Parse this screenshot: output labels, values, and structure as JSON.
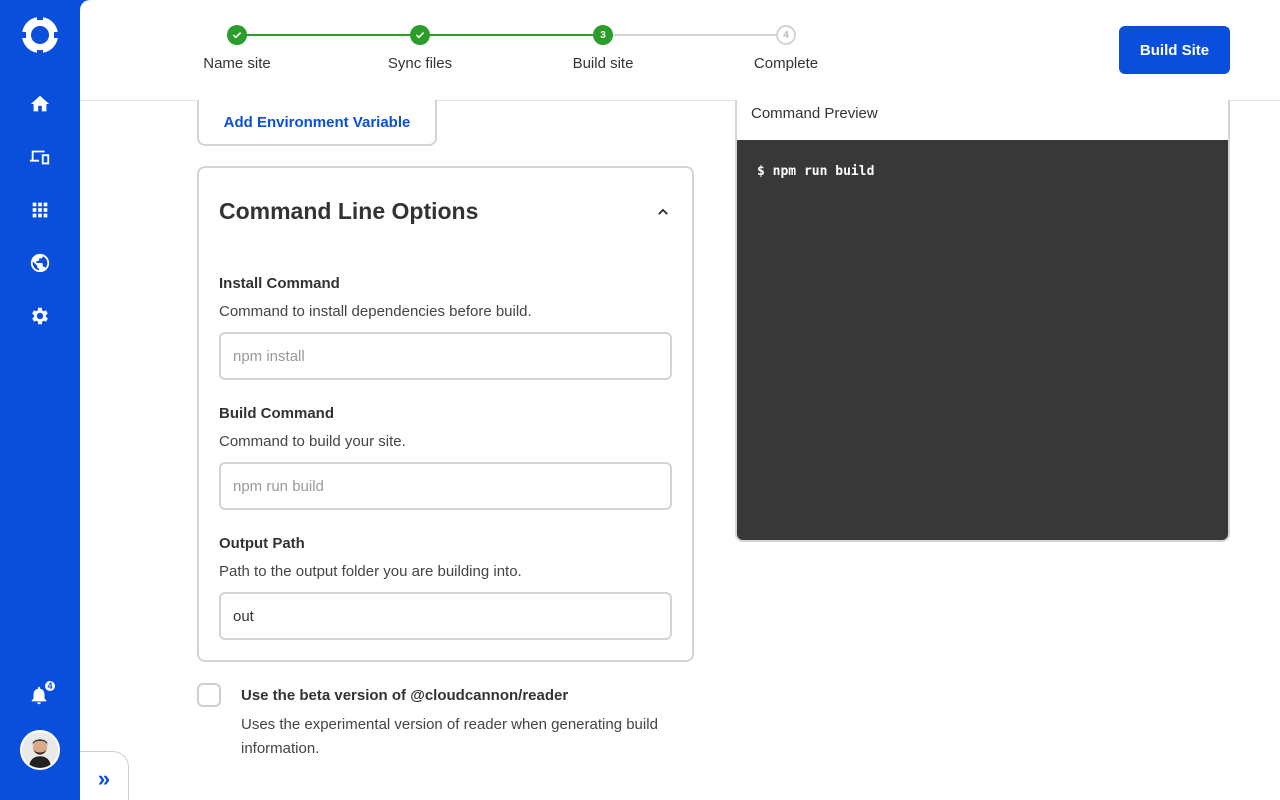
{
  "sidebar": {
    "nav": [
      "home-icon",
      "devices-icon",
      "apps-grid-icon",
      "globe-icon",
      "gear-icon"
    ],
    "notifications_count": "4"
  },
  "stepper": {
    "steps": [
      {
        "label": "Name site",
        "state": "done"
      },
      {
        "label": "Sync files",
        "state": "done"
      },
      {
        "label": "Build site",
        "state": "active",
        "number": "3"
      },
      {
        "label": "Complete",
        "state": "pending",
        "number": "4"
      }
    ]
  },
  "header": {
    "build_button": "Build Site"
  },
  "env": {
    "add_button": "Add Environment Variable"
  },
  "options": {
    "title": "Command Line Options",
    "install": {
      "label": "Install Command",
      "help": "Command to install dependencies before build.",
      "placeholder": "npm install",
      "value": ""
    },
    "build": {
      "label": "Build Command",
      "help": "Command to build your site.",
      "placeholder": "npm run build",
      "value": ""
    },
    "output": {
      "label": "Output Path",
      "help": "Path to the output folder you are building into.",
      "placeholder": "",
      "value": "out"
    }
  },
  "beta": {
    "label": "Use the beta version of @cloudcannon/reader",
    "help": "Uses the experimental version of reader when generating build information."
  },
  "preview": {
    "title": "Command Preview",
    "command": "$ npm run build"
  },
  "colors": {
    "brand": "#0a4fdc",
    "success": "#2a9d2a",
    "terminal": "#383838"
  }
}
